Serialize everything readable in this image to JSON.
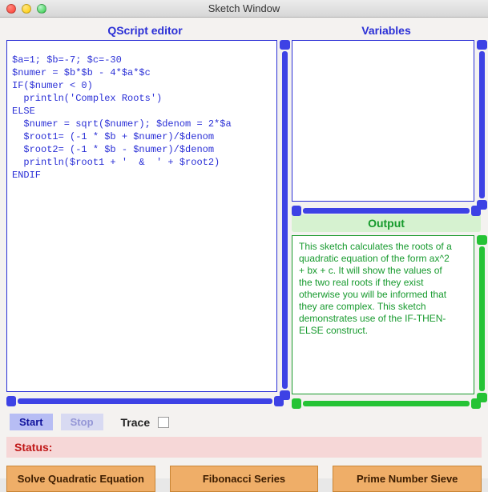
{
  "window": {
    "title": "Sketch Window"
  },
  "headers": {
    "editor": "QScript editor",
    "variables": "Variables",
    "output": "Output"
  },
  "editor": {
    "code": "$a=1; $b=-7; $c=-30\n$numer = $b*$b - 4*$a*$c\nIF($numer < 0)\n  println('Complex Roots')\nELSE\n  $numer = sqrt($numer); $denom = 2*$a\n  $root1= (-1 * $b + $numer)/$denom\n  $root2= (-1 * $b - $numer)/$denom\n  println($root1 + '  &  ' + $root2)\nENDIF"
  },
  "variables": {
    "content": ""
  },
  "output": {
    "text": "This sketch calculates the roots of a quadratic equation of the form ax^2 + bx + c. It will show the values of the two real roots if they exist otherwise you will  be informed that they are complex. This sketch demonstrates use of the IF-THEN-ELSE construct."
  },
  "controls": {
    "start": "Start",
    "stop": "Stop",
    "trace": "Trace"
  },
  "status": {
    "label": "Status:",
    "value": ""
  },
  "buttons": {
    "quad": "Solve Quadratic Equation",
    "fib": "Fibonacci Series",
    "sieve": "Prime Number Sieve"
  }
}
